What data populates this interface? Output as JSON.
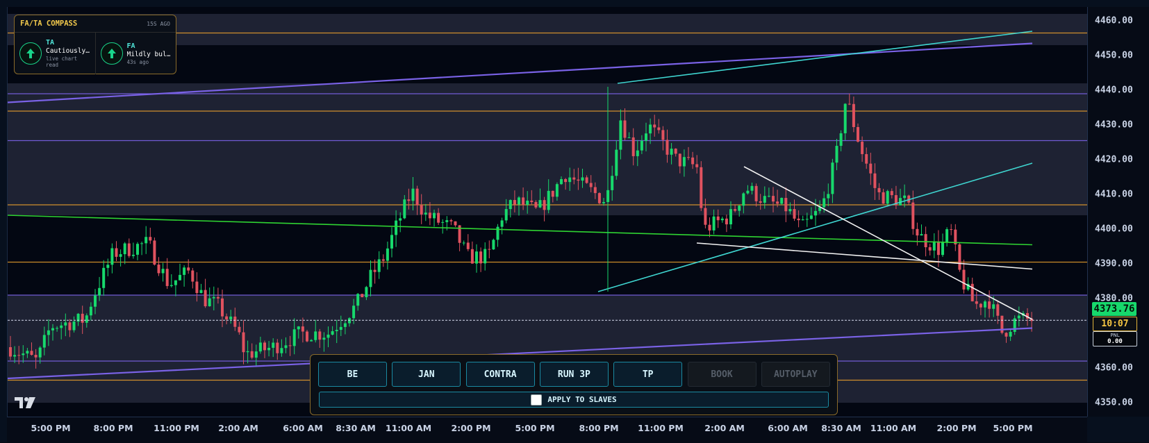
{
  "compass": {
    "title": "FA/TA COMPASS",
    "age": "15S AGO",
    "ta": {
      "name": "TA",
      "status": "Cautiously…",
      "sub1": "live chart",
      "sub2": "read",
      "direction_icon": "arrow-up-icon"
    },
    "fa": {
      "name": "FA",
      "status": "Mildly bul…",
      "sub1": "43s ago",
      "direction_icon": "arrow-up-icon"
    }
  },
  "price_axis": {
    "ticks": [
      "4460.00",
      "4450.00",
      "4440.00",
      "4430.00",
      "4420.00",
      "4410.00",
      "4400.00",
      "4390.00",
      "4380.00",
      "4360.00",
      "4350.00"
    ],
    "current_price": "4373.76",
    "countdown": "10:07",
    "pnl_label": "PNL",
    "pnl_value": "0.00"
  },
  "time_axis": {
    "ticks": [
      "5:00 PM",
      "8:00 PM",
      "11:00 PM",
      "2:00 AM",
      "6:00 AM",
      "8:30 AM",
      "11:00 AM",
      "2:00 PM",
      "5:00 PM",
      "8:00 PM",
      "11:00 PM",
      "2:00 AM",
      "6:00 AM",
      "8:30 AM",
      "11:00 AM",
      "2:00 PM",
      "5:00 PM"
    ]
  },
  "panel": {
    "buttons": [
      {
        "label": "BE",
        "enabled": true
      },
      {
        "label": "JAN",
        "enabled": true
      },
      {
        "label": "CONTRA",
        "enabled": true
      },
      {
        "label": "RUN 3P",
        "enabled": true
      },
      {
        "label": "TP",
        "enabled": true
      },
      {
        "label": "BOOK",
        "enabled": false
      },
      {
        "label": "AUTOPLAY",
        "enabled": false
      }
    ],
    "apply_label": "APPLY TO SLAVES",
    "apply_checked": false
  },
  "logo": "tradingview-logo",
  "colors": {
    "up": "#17d96c",
    "down": "#e0525f",
    "purple": "#7a62e6",
    "orange": "#e39a2c",
    "cyan": "#3fd6d1",
    "green_line": "#2fd432",
    "accent_gold": "#f2c94c"
  },
  "chart_data": {
    "type": "candlestick",
    "ylim": [
      4346,
      4464
    ],
    "ytick_values": [
      4460,
      4450,
      4440,
      4430,
      4420,
      4410,
      4400,
      4390,
      4380,
      4360,
      4350
    ],
    "current_price": 4373.76,
    "horizontal_levels": [
      {
        "value": 4456.5,
        "color": "orange"
      },
      {
        "value": 4439,
        "color": "purple"
      },
      {
        "value": 4434,
        "color": "orange"
      },
      {
        "value": 4425.5,
        "color": "purple"
      },
      {
        "value": 4407,
        "color": "orange"
      },
      {
        "value": 4390.5,
        "color": "orange"
      },
      {
        "value": 4381,
        "color": "purple"
      },
      {
        "value": 4362,
        "color": "purple"
      },
      {
        "value": 4356.5,
        "color": "orange"
      }
    ],
    "zones": [
      {
        "from": 4453,
        "to": 4462
      },
      {
        "from": 4404,
        "to": 4442
      },
      {
        "from": 4350,
        "to": 4381
      }
    ]
  }
}
